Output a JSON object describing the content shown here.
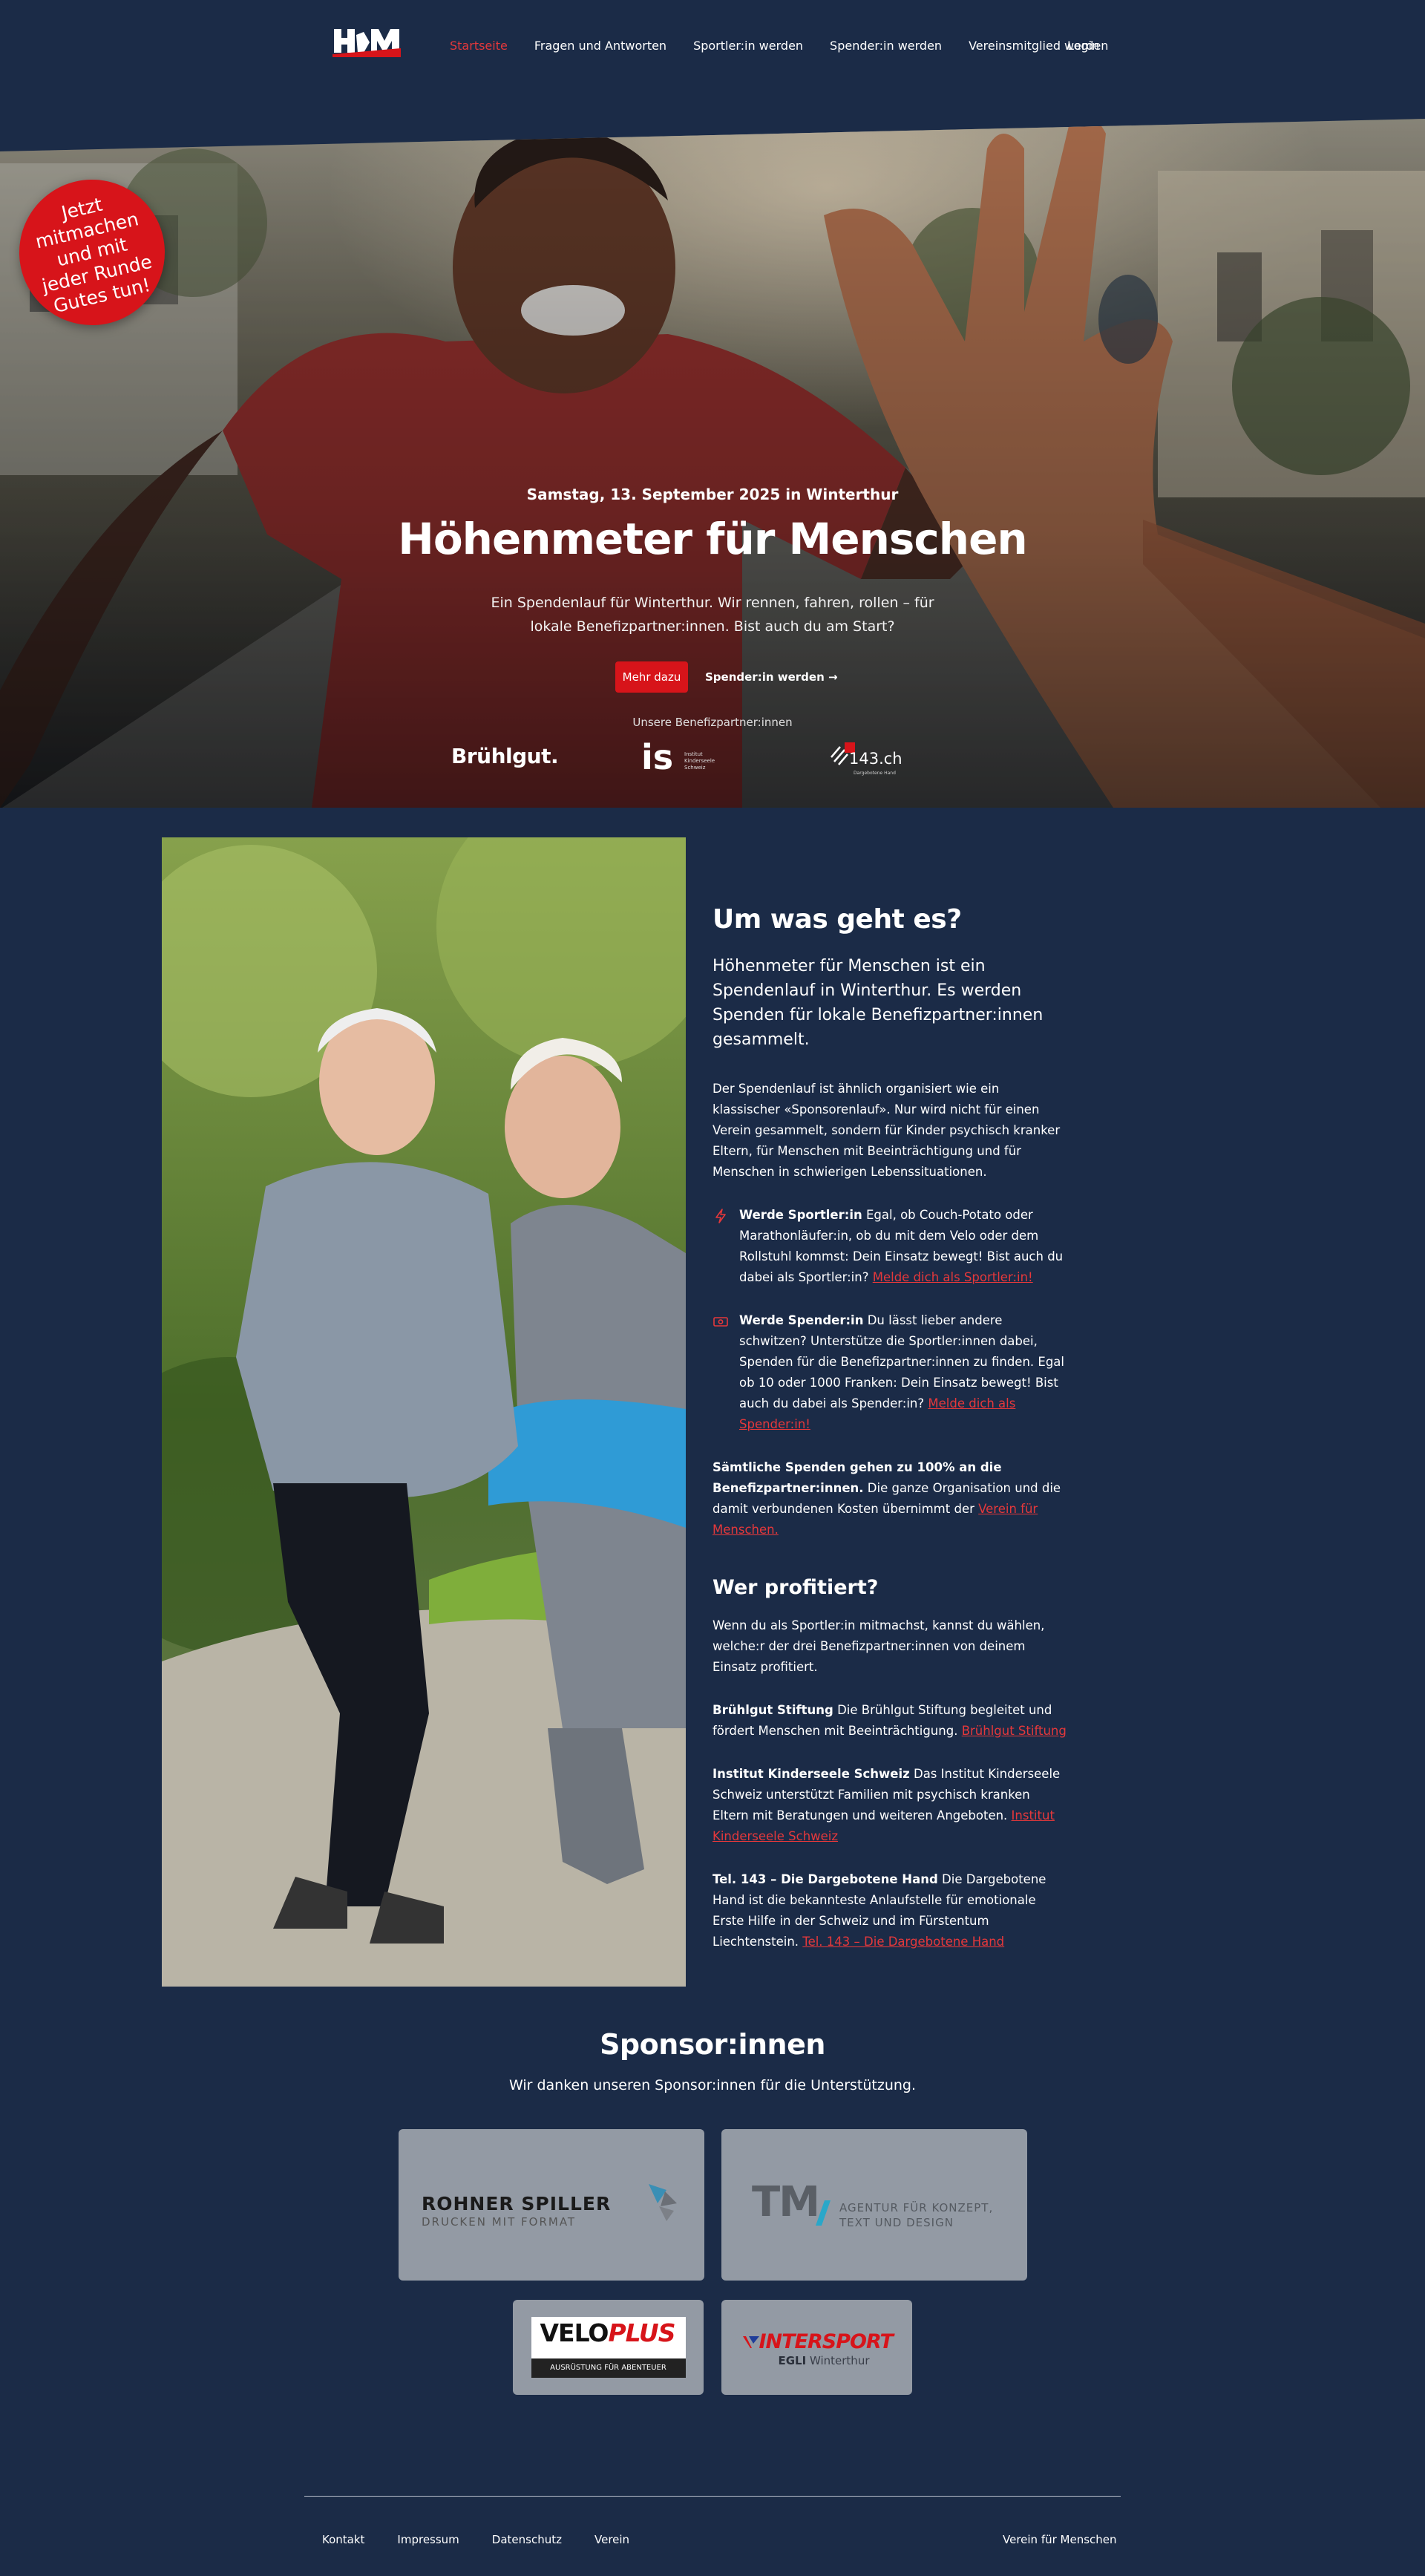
{
  "nav": {
    "logo_text": "HfM",
    "items": [
      "Startseite",
      "Fragen und Antworten",
      "Sportler:in werden",
      "Spender:in werden",
      "Vereinsmitglied werden"
    ],
    "login": "Login",
    "active_color": "#e5383b"
  },
  "hero": {
    "badge": "Jetzt mitmachen und mit jeder Runde Gutes tun!",
    "date": "Samstag, 13. September 2025 in Winterthur",
    "title": "Höhenmeter für Menschen",
    "subtitle": "Ein Spendenlauf für Winterthur. Wir rennen, fahren, rollen – für lokale Benefizpartner:innen. Bist auch du am Start?",
    "btn_primary": "Mehr dazu",
    "btn_secondary": "Spender:in werden →",
    "partners_label": "Unsere Benefizpartner:innen",
    "partner_bruhl": "Brühlgut.",
    "partner_is": "is",
    "partner_is_small": [
      "Institut",
      "Kinderseele",
      "Schweiz"
    ],
    "partner_143": "143.ch",
    "partner_143_small": "Dargebotene Hand"
  },
  "about": {
    "title": "Um was geht es?",
    "lead": "Höhenmeter für Menschen ist ein Spendenlauf in Winterthur. Es werden Spenden für lokale Benefizpartner:innen gesammelt.",
    "para": "Der Spendenlauf ist ähnlich organisiert wie ein klassischer «Sponsorenlauf». Nur wird nicht für einen Verein gesammelt, sondern für Kinder psychisch kranker Eltern, für Menschen mit Beeinträchtigung und für Menschen in schwierigen Lebenssituationen.",
    "feat1_bold": "Werde Sportler:in",
    "feat1_text": " Egal, ob Couch-Potato oder Marathonläufer:in, ob du mit dem Velo oder dem Rollstuhl kommst: Dein Einsatz bewegt! Bist auch du dabei als Sportler:in? ",
    "feat1_link": "Melde dich als Sportler:in!",
    "feat2_bold": "Werde Spender:in",
    "feat2_text": " Du lässt lieber andere schwitzen? Unterstütze die Sportler:innen dabei, Spenden für die Benefizpartner:innen zu finden. Egal ob 10 oder 1000 Franken: Dein Einsatz bewegt! Bist auch du dabei als Spender:in? ",
    "feat2_link": "Melde dich als Spender:in!",
    "donate_bold": "Sämtliche Spenden gehen zu 100% an die Benefizpartner:innen.",
    "donate_text": " Die ganze Organisation und die damit verbundenen Kosten übernimmt der ",
    "donate_link": "Verein für Menschen.",
    "h3": "Wer profitiert?",
    "who_intro": "Wenn du als Sportler:in mitmachst, kannst du wählen, welche:r der drei Benefizpartner:innen von deinem Einsatz profitiert.",
    "b1_bold": "Brühlgut Stiftung",
    "b1_text": " Die Brühlgut Stiftung begleitet und fördert Menschen mit Beeinträchtigung. ",
    "b1_link": "Brühlgut Stiftung",
    "b2_bold": "Institut Kinderseele Schweiz",
    "b2_text": " Das Institut Kinderseele Schweiz unterstützt Familien mit psychisch kranken Eltern mit Beratungen und weiteren Angeboten. ",
    "b2_link": "Institut Kinderseele Schweiz",
    "b3_bold": "Tel. 143 – Die Dargebotene Hand",
    "b3_text": " Die Dargebotene Hand ist die bekannteste Anlaufstelle für emotionale Erste Hilfe in der Schweiz und im Fürstentum Liechtenstein. ",
    "b3_link": "Tel. 143 – Die Dargebotene Hand"
  },
  "sponsors": {
    "title": "Sponsor:innen",
    "subtitle": "Wir danken unseren Sponsor:innen für die Unterstützung.",
    "rohner_main": "ROHNER SPILLER",
    "rohner_sub": "DRUCKEN MIT FORMAT",
    "tm_main": "TM",
    "tm_sub1": "AGENTUR FÜR KONZEPT,",
    "tm_sub2": "TEXT UND DESIGN",
    "velo_a": "VELO",
    "velo_b": "PLUS",
    "velo_sub": "AUSRÜSTUNG FÜR ABENTEUER",
    "inter_main": "INTERSPORT",
    "inter_sub_a": "EGLI",
    "inter_sub_b": " Winterthur"
  },
  "footer": {
    "links": [
      "Kontakt",
      "Impressum",
      "Datenschutz",
      "Verein"
    ],
    "right": "Verein für Menschen"
  }
}
